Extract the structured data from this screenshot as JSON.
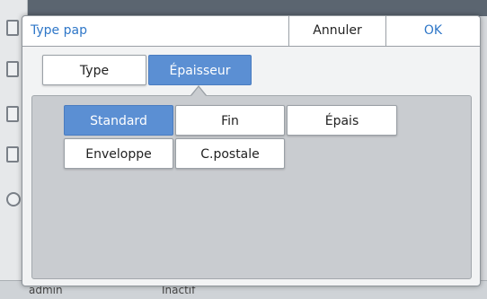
{
  "dialog": {
    "title": "Type pap",
    "cancel_label": "Annuler",
    "ok_label": "OK"
  },
  "tabs": [
    {
      "label": "Type",
      "selected": false
    },
    {
      "label": "Épaisseur",
      "selected": true
    }
  ],
  "thickness_options": [
    {
      "label": "Standard",
      "selected": true
    },
    {
      "label": "Fin",
      "selected": false
    },
    {
      "label": "Épais",
      "selected": false
    },
    {
      "label": "Enveloppe",
      "selected": false
    },
    {
      "label": "C.postale",
      "selected": false
    }
  ],
  "background": {
    "bottom_left_text": "admin",
    "bottom_mid_text": "Inactif"
  },
  "colors": {
    "accent": "#5b8fd3",
    "title_blue": "#2f77c8",
    "panel": "#c9ccd0"
  }
}
